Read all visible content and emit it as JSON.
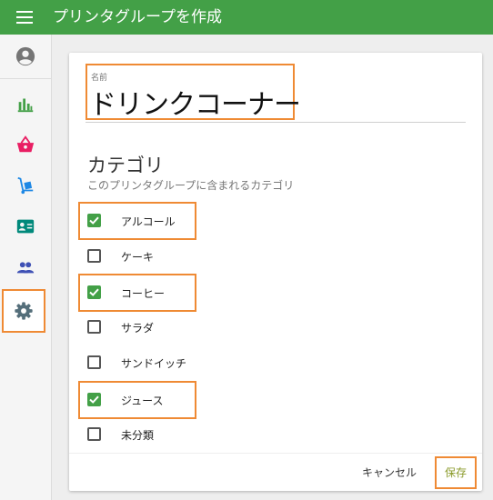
{
  "appbar": {
    "title": "プリンタグループを作成",
    "menu_icon": "menu-icon"
  },
  "sidebar": {
    "items": [
      {
        "name": "account",
        "icon": "account-circle-icon",
        "color": "#757575"
      },
      {
        "name": "reports",
        "icon": "bar-chart-icon",
        "color": "#43a047"
      },
      {
        "name": "shop",
        "icon": "basket-icon",
        "color": "#e91e63"
      },
      {
        "name": "delivery",
        "icon": "hand-truck-icon",
        "color": "#1e88e5"
      },
      {
        "name": "contacts",
        "icon": "contact-card-icon",
        "color": "#00897b"
      },
      {
        "name": "users",
        "icon": "people-icon",
        "color": "#3f51b5"
      },
      {
        "name": "settings",
        "icon": "gear-icon",
        "color": "#546e7a",
        "highlighted": true
      }
    ]
  },
  "form": {
    "name_label": "名前",
    "name_value": "ドリンクコーナー",
    "category_title": "カテゴリ",
    "category_subtitle": "このプリンタグループに含まれるカテゴリ",
    "categories": [
      {
        "label": "アルコール",
        "checked": true,
        "highlighted": true
      },
      {
        "label": "ケーキ",
        "checked": false,
        "highlighted": false
      },
      {
        "label": "コーヒー",
        "checked": true,
        "highlighted": true
      },
      {
        "label": "サラダ",
        "checked": false,
        "highlighted": false
      },
      {
        "label": "サンドイッチ",
        "checked": false,
        "highlighted": false
      },
      {
        "label": "ジュース",
        "checked": true,
        "highlighted": true
      },
      {
        "label": "未分類",
        "checked": false,
        "highlighted": false
      }
    ]
  },
  "actions": {
    "cancel_label": "キャンセル",
    "save_label": "保存"
  },
  "colors": {
    "accent": "#43a047",
    "highlight": "#ef8a34",
    "save_text": "#8a9a2a"
  }
}
